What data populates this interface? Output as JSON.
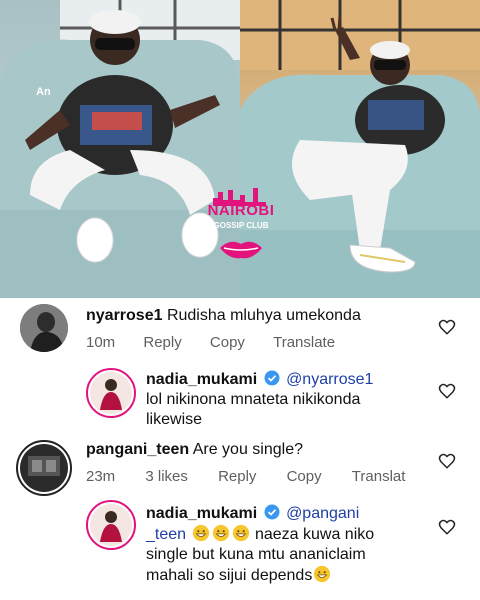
{
  "photo": {
    "watermark_left": "An",
    "logo": {
      "title": "NAIROBI",
      "subtitle": "GOSSIP CLUB"
    }
  },
  "comments": [
    {
      "username": "nyarrose1",
      "text": "Rudisha mluhya umekonda",
      "time": "10m",
      "reply_label": "Reply",
      "copy_label": "Copy",
      "translate_label": "Translate",
      "replies": [
        {
          "username": "nadia_mukami",
          "verified": true,
          "mention": "@nyarrose1",
          "text_line1": "lol  nikinona mnateta nikikonda",
          "text_line2": "likewise"
        }
      ]
    },
    {
      "username": "pangani_teen",
      "text": "Are you single?",
      "time": "23m",
      "likes": "3 likes",
      "reply_label": "Reply",
      "copy_label": "Copy",
      "translate_label": "Translat",
      "replies": [
        {
          "username": "nadia_mukami",
          "verified": true,
          "mention_part1": "@pangani",
          "mention_part2": "_teen",
          "emoji": "grinning-face-emoji",
          "text_line2_rest": "naeza kuwa niko",
          "text_line3": "single but kuna mtu ananiclaim",
          "text_line4": "mahali so sijui depends"
        }
      ]
    }
  ],
  "colors": {
    "verified": "#3897f0",
    "mention": "#1f3fa6",
    "meta": "#5f5f5f",
    "logo_pink": "#e2137d"
  }
}
